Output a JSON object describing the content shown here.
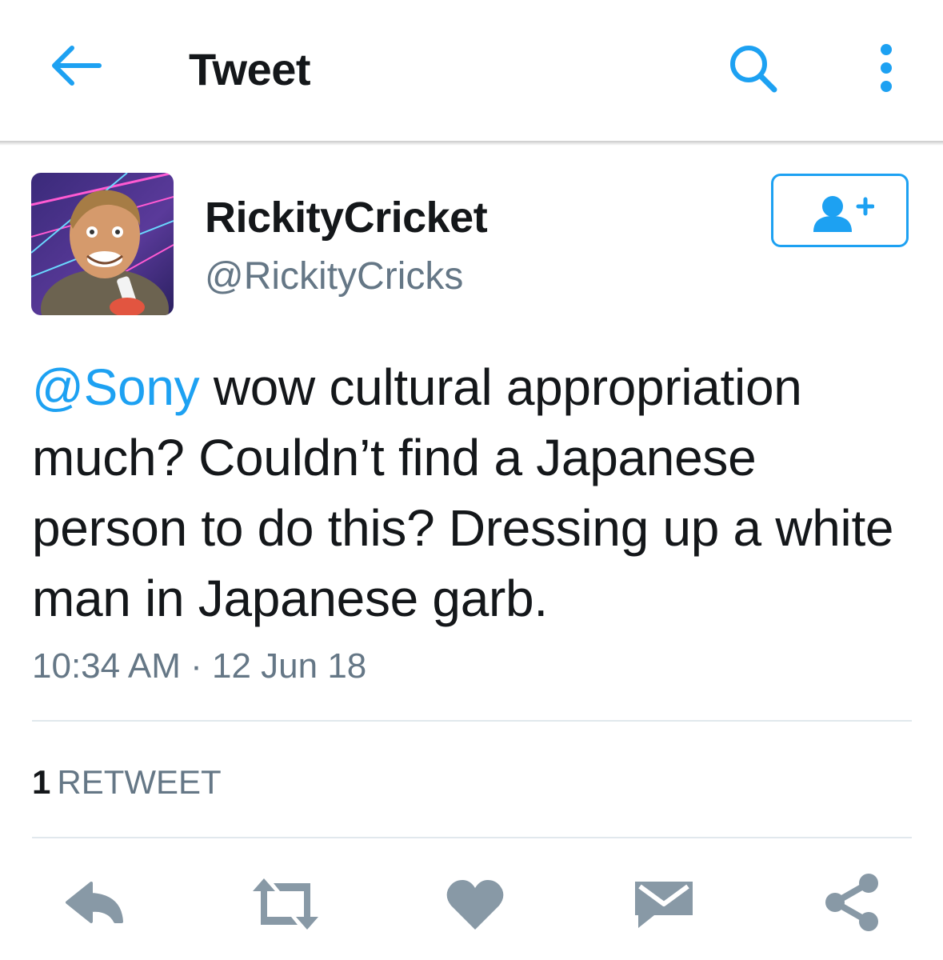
{
  "app_bar": {
    "title": "Tweet",
    "back_icon": "arrow-left-icon",
    "search_icon": "search-icon",
    "overflow_icon": "more-vertical-icon"
  },
  "tweet": {
    "author": {
      "display_name": "RickityCricket",
      "handle": "@RickityCricks"
    },
    "follow_icon": "add-user-icon",
    "text_mention": "@Sony",
    "text_body": " wow cultural appropriation much? Couldn’t find a Japanese person to do this? Dressing up a white man in Japanese garb.",
    "timestamp": "10:34 AM · 12 Jun 18",
    "retweet_count": "1",
    "retweet_label": "RETWEET"
  },
  "actions": [
    "reply-icon",
    "retweet-icon",
    "like-icon",
    "direct-message-icon",
    "share-icon"
  ],
  "colors": {
    "accent": "#1da1f2",
    "secondary_text": "#657786",
    "action_icons": "#8899a6",
    "divider": "#e1e8ed"
  }
}
